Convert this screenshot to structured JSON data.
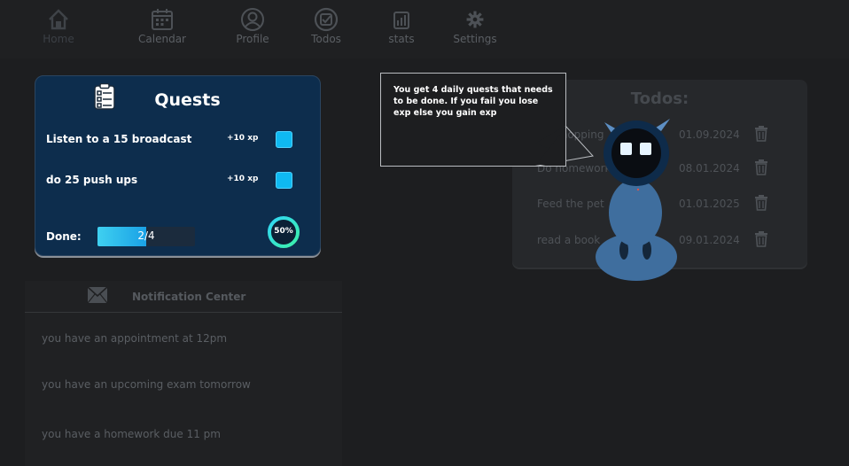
{
  "nav": {
    "items": [
      {
        "label": "Home",
        "icon": "home-icon",
        "active": true
      },
      {
        "label": "Calendar",
        "icon": "calendar-icon"
      },
      {
        "label": "Profile",
        "icon": "profile-icon"
      },
      {
        "label": "Todos",
        "icon": "todos-icon"
      },
      {
        "label": "stats",
        "icon": "stats-icon"
      },
      {
        "label": "Settings",
        "icon": "gear-icon"
      }
    ]
  },
  "quests": {
    "title": "Quests",
    "icon": "checklist-icon",
    "items": [
      {
        "text": "Listen to a 15 broadcast",
        "xp": "+10 xp",
        "checked": true
      },
      {
        "text": "do 25 push ups",
        "xp": "+10 xp",
        "checked": true
      }
    ],
    "done_label": "Done:",
    "progress_text": "2/4",
    "progress_value": 0.5,
    "percent_label": "50%",
    "percent_value": 0.5
  },
  "notifications": {
    "title": "Notification Center",
    "icon": "envelope-icon",
    "items": [
      "you have an appointment at 12pm",
      "you have an upcoming exam tomorrow",
      "you have a homework due 11 pm"
    ]
  },
  "todos": {
    "title": "Todos:",
    "items": [
      {
        "text": "Go shopping",
        "date": "01.09.2024"
      },
      {
        "text": "Do homework",
        "date": "08.01.2024"
      },
      {
        "text": "Feed the pet",
        "date": "01.01.2025"
      },
      {
        "text": "read a book",
        "date": "09.01.2024"
      }
    ]
  },
  "tooltip": {
    "text": "You get 4 daily quests that needs to be done. If you fail you lose exp else you gain exp"
  },
  "colors": {
    "accent": "#0fb9f2",
    "card_bg": "#0d2d4d",
    "page_bg": "#1d1e20",
    "mascot": "#3f6e9e"
  }
}
